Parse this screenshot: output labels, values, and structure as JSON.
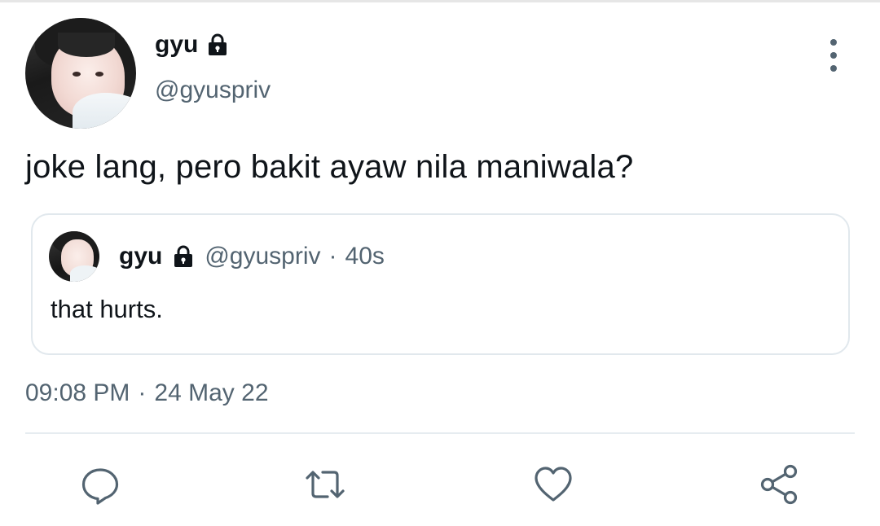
{
  "tweet": {
    "display_name": "gyu",
    "handle": "@gyuspriv",
    "text": "joke lang, pero bakit ayaw nila maniwala?",
    "time": "09:08 PM",
    "separator": "·",
    "date": "24 May 22",
    "locked": true
  },
  "quoted_tweet": {
    "display_name": "gyu",
    "handle": "@gyuspriv",
    "separator": "·",
    "age": "40s",
    "text": "that hurts.",
    "locked": true
  },
  "icons": {
    "lock": "lock-icon",
    "more": "more-vertical-icon",
    "reply": "reply-icon",
    "retweet": "retweet-icon",
    "like": "heart-icon",
    "share": "share-icon"
  },
  "colors": {
    "text_primary": "#0f1419",
    "text_secondary": "#536471",
    "border": "#e1e8ed",
    "background": "#ffffff"
  }
}
